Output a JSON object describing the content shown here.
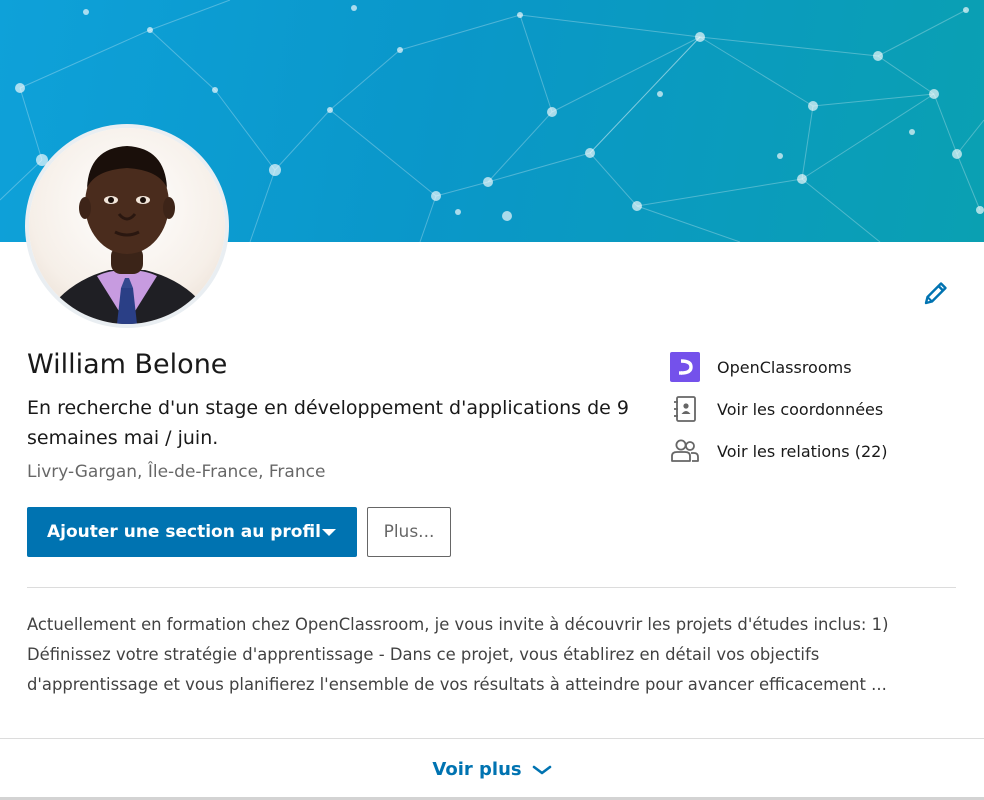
{
  "profile": {
    "name": "William Belone",
    "headline": "En recherche d'un stage en développement d'applications de 9 semaines mai / juin.",
    "location": "Livry-Gargan, Île-de-France, France"
  },
  "actions": {
    "add_section_label": "Ajouter une section au profil",
    "more_label": "Plus..."
  },
  "side_links": {
    "school": {
      "label": "OpenClassrooms",
      "icon": "openclassrooms-logo-icon"
    },
    "contact": {
      "label": "Voir les coordonnées",
      "icon": "contact-card-icon"
    },
    "connections": {
      "label": "Voir les relations (22)",
      "icon": "people-icon"
    }
  },
  "summary": {
    "lines": [
      "Actuellement en formation chez OpenClassroom, je vous invite à découvrir les projets d'études inclus: 1)",
      "Définissez votre stratégie d'apprentissage - Dans ce projet, vous établirez en détail vos objectifs",
      "d'apprentissage et vous planifierez l'ensemble de vos résultats à atteindre pour avancer efficacement ..."
    ]
  },
  "footer": {
    "see_more_label": "Voir plus"
  },
  "colors": {
    "brand_blue": "#0073b1",
    "banner_start": "#0ea1d9",
    "banner_end": "#0aa0b2",
    "openclassrooms_purple": "#7451eb"
  }
}
